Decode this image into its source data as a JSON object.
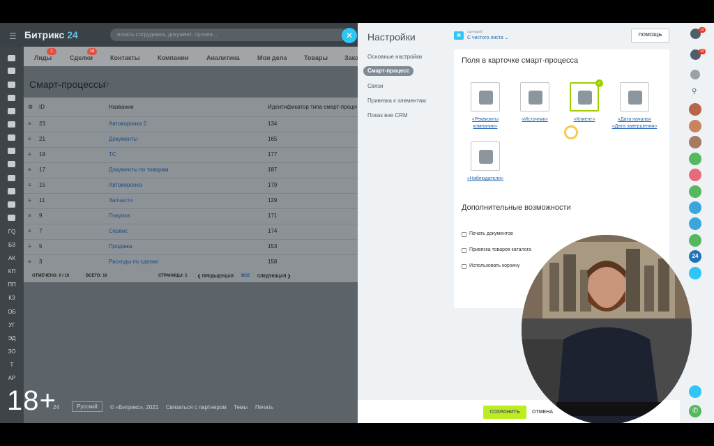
{
  "age_rating": "18+",
  "brand": {
    "name": "Битрикс",
    "num": "24"
  },
  "search": {
    "placeholder": "искать сотрудника, документ, прочее..."
  },
  "left_nav_labels": [
    "ГQ",
    "БЗ",
    "АК",
    "КП",
    "ПП",
    "КЗ",
    "ОБ",
    "УГ",
    "ЭД",
    "ЗО",
    "Т",
    "АР"
  ],
  "tabs": [
    {
      "label": "Лиды",
      "badge": "1"
    },
    {
      "label": "Сделки",
      "badge": "16"
    },
    {
      "label": "Контакты",
      "badge": ""
    },
    {
      "label": "Компании",
      "badge": ""
    },
    {
      "label": "Аналитика",
      "badge": ""
    },
    {
      "label": "Мои дела",
      "badge": ""
    },
    {
      "label": "Товары",
      "badge": ""
    },
    {
      "label": "Зака",
      "badge": ""
    }
  ],
  "page_title": "Смарт-процессы",
  "table": {
    "headers": {
      "id": "ID",
      "name": "Название",
      "type_id": "Идентификатор типа смарт-процесса"
    },
    "rows": [
      {
        "id": "23",
        "name": "Автоворонка 2",
        "type": "134"
      },
      {
        "id": "21",
        "name": "Документы",
        "type": "165"
      },
      {
        "id": "19",
        "name": "ТС",
        "type": "177"
      },
      {
        "id": "17",
        "name": "Документы по товарам",
        "type": "187"
      },
      {
        "id": "15",
        "name": "Автоворонка",
        "type": "179"
      },
      {
        "id": "11",
        "name": "Запчасти",
        "type": "129"
      },
      {
        "id": "9",
        "name": "Покупка",
        "type": "171"
      },
      {
        "id": "7",
        "name": "Сервис",
        "type": "174"
      },
      {
        "id": "5",
        "name": "Продажа",
        "type": "153"
      },
      {
        "id": "3",
        "name": "Расходы по сделке",
        "type": "158"
      }
    ],
    "footer": {
      "marked": "ОТМЕЧЕНО: 0 / 10",
      "total": "ВСЕГО: 10",
      "pages": "СТРАНИЦЫ: 1",
      "prev": "❮ ПРЕДЫДУЩАЯ",
      "all": "ВСЕ",
      "next": "СЛЕДУЮЩАЯ ❯"
    }
  },
  "bottom_footer": {
    "brand": "24",
    "lang": "Русский",
    "copyright": "© «Битрикс», 2021",
    "partner": "Связаться с партнером",
    "themes": "Темы",
    "print": "Печать"
  },
  "panel": {
    "title": "Настройки",
    "scenario_label": "сценарий",
    "scenario_value": "С чистого листа ⌄",
    "help_button": "ПОМОЩЬ",
    "menu": [
      "Основные настройки",
      "Смарт-процесс",
      "Связи",
      "Привязка к элементам",
      "Показ вне CRM"
    ],
    "fields_title": "Поля в карточке смарт-процесса",
    "fields": [
      {
        "label": "«Реквизиты компании»",
        "selected": false
      },
      {
        "label": "«Источник»",
        "selected": false
      },
      {
        "label": "«Клиент»",
        "selected": true
      },
      {
        "label": "«Дата начала» «Дата завершения»",
        "selected": false
      },
      {
        "label": "«Наблюдатели»",
        "selected": false
      }
    ],
    "extra_title": "Дополнительные возможности",
    "options": [
      "Печать документов",
      "Привязка товаров каталога",
      "Использовать корзину"
    ],
    "save": "СОХРАНИТЬ",
    "cancel": "ОТМЕНА"
  },
  "right_bar": {
    "badges": [
      "13",
      "20"
    ],
    "avatar_24": "24"
  },
  "colors": {
    "accent": "#2fc6f6",
    "save": "#bbed21",
    "link": "#2067b0"
  }
}
